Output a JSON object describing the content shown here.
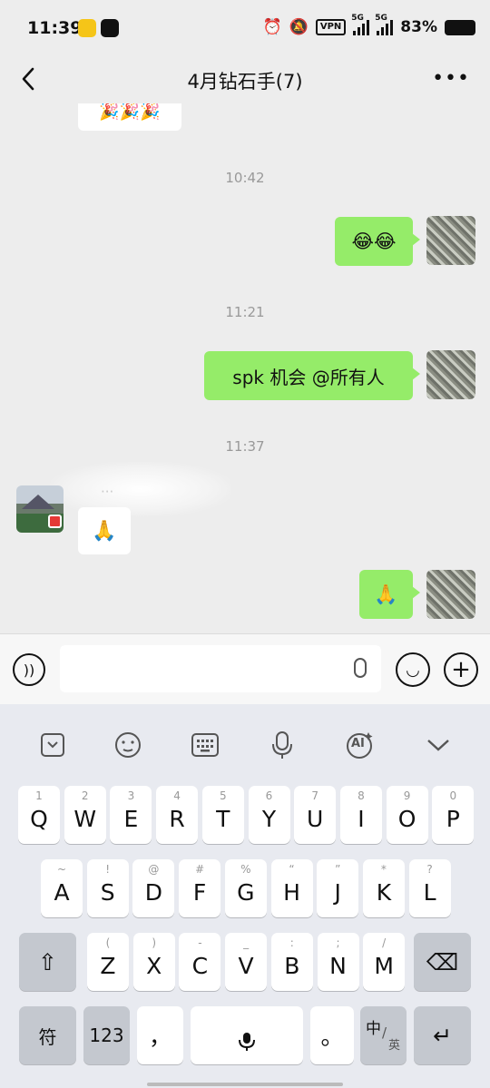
{
  "status_bar": {
    "time": "11:39",
    "vpn": "VPN",
    "net1": "5G",
    "net2": "5G",
    "battery": "83%"
  },
  "nav": {
    "title": "4月钻石手(7)",
    "back_icon": "chevron-left-icon",
    "more": "•••"
  },
  "chat": {
    "top_bubble_emoji": "🎉🎉🎉",
    "messages": [
      {
        "timestamp": "10:42",
        "from": "me",
        "text": "😂😂"
      },
      {
        "timestamp": "11:21",
        "from": "me",
        "text": "spk 机会 @所有人"
      },
      {
        "timestamp": "11:37",
        "from": "other",
        "text": "🙏"
      },
      {
        "from": "me",
        "text": "🙏"
      }
    ]
  },
  "input_bar": {
    "voice_icon": "voice-icon",
    "emoji_icon": "emoji-icon",
    "plus_icon": "plus-icon"
  },
  "keyboard": {
    "toolbar_icons": [
      "collapse-icon",
      "sticker-icon",
      "keyboard-icon",
      "mic-icon",
      "ai-icon",
      "chevron-down-icon"
    ],
    "toolbar_ai_label": "AI",
    "row1": [
      {
        "k": "Q",
        "h": "1"
      },
      {
        "k": "W",
        "h": "2"
      },
      {
        "k": "E",
        "h": "3"
      },
      {
        "k": "R",
        "h": "4"
      },
      {
        "k": "T",
        "h": "5"
      },
      {
        "k": "Y",
        "h": "6"
      },
      {
        "k": "U",
        "h": "7"
      },
      {
        "k": "I",
        "h": "8"
      },
      {
        "k": "O",
        "h": "9"
      },
      {
        "k": "P",
        "h": "0"
      }
    ],
    "row2": [
      {
        "k": "A",
        "h": "~"
      },
      {
        "k": "S",
        "h": "!"
      },
      {
        "k": "D",
        "h": "@"
      },
      {
        "k": "F",
        "h": "#"
      },
      {
        "k": "G",
        "h": "%"
      },
      {
        "k": "H",
        "h": "“"
      },
      {
        "k": "J",
        "h": "”"
      },
      {
        "k": "K",
        "h": "*"
      },
      {
        "k": "L",
        "h": "?"
      }
    ],
    "row3": [
      {
        "k": "Z",
        "h": "("
      },
      {
        "k": "X",
        "h": ")"
      },
      {
        "k": "C",
        "h": "-"
      },
      {
        "k": "V",
        "h": "_"
      },
      {
        "k": "B",
        "h": ":"
      },
      {
        "k": "N",
        "h": ";"
      },
      {
        "k": "M",
        "h": "/"
      }
    ],
    "shift": "⇧",
    "backspace": "⌫",
    "fu": "符",
    "num": "123",
    "comma": "，",
    "period": "。",
    "lang_main": "中",
    "lang_sub": "英",
    "enter": "↵"
  }
}
